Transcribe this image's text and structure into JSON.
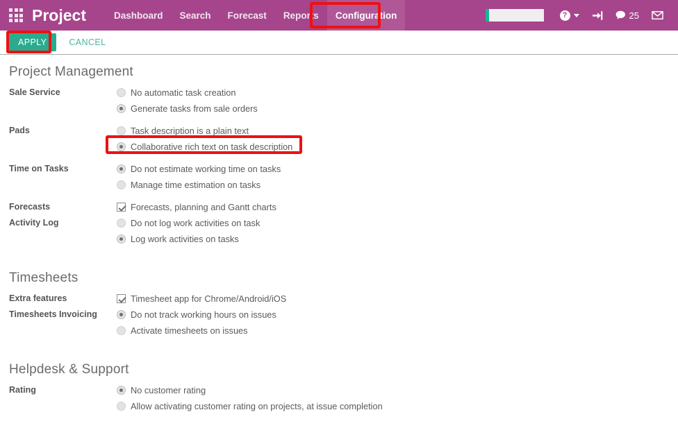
{
  "navbar": {
    "apps_icon": "apps-grid-icon",
    "brand": "Project",
    "menu": [
      {
        "label": "Dashboard",
        "active": false
      },
      {
        "label": "Search",
        "active": false
      },
      {
        "label": "Forecast",
        "active": false
      },
      {
        "label": "Reports",
        "active": false
      },
      {
        "label": "Configuration",
        "active": true
      }
    ],
    "search": {
      "value": "",
      "placeholder": ""
    },
    "help_icon": "question-mark-icon",
    "caret_icon": "chevron-down-icon",
    "signin_icon": "sign-in-arrow-icon",
    "messages_icon": "speech-bubble-icon",
    "messages_count": "25",
    "mail_icon": "envelope-icon",
    "background_color": "#a6458c",
    "active_color": "#b05798"
  },
  "toolbar": {
    "apply_label": "APPLY",
    "cancel_label": "CANCEL",
    "apply_color": "#2aab8e",
    "cancel_color": "#4ab5a0"
  },
  "sections": [
    {
      "title": "Project Management",
      "rows": [
        {
          "label": "Sale Service",
          "options": [
            {
              "type": "radio",
              "checked": false,
              "label": "No automatic task creation"
            },
            {
              "type": "radio",
              "checked": true,
              "label": "Generate tasks from sale orders"
            }
          ]
        },
        {
          "label": "Pads",
          "options": [
            {
              "type": "radio",
              "checked": false,
              "label": "Task description is a plain text"
            },
            {
              "type": "radio",
              "checked": true,
              "label": "Collaborative rich text on task description"
            }
          ]
        },
        {
          "label": "Time on Tasks",
          "options": [
            {
              "type": "radio",
              "checked": true,
              "label": "Do not estimate working time on tasks"
            },
            {
              "type": "radio",
              "checked": false,
              "label": "Manage time estimation on tasks"
            }
          ]
        },
        {
          "label": "Forecasts",
          "options": [
            {
              "type": "checkbox",
              "checked": true,
              "label": "Forecasts, planning and Gantt charts"
            }
          ]
        },
        {
          "label": "Activity Log",
          "options": [
            {
              "type": "radio",
              "checked": false,
              "label": "Do not log work activities on task"
            },
            {
              "type": "radio",
              "checked": true,
              "label": "Log work activities on tasks"
            }
          ]
        }
      ]
    },
    {
      "title": "Timesheets",
      "rows": [
        {
          "label": "Extra features",
          "options": [
            {
              "type": "checkbox",
              "checked": true,
              "label": "Timesheet app for Chrome/Android/iOS"
            }
          ]
        },
        {
          "label": "Timesheets Invoicing",
          "options": [
            {
              "type": "radio",
              "checked": true,
              "label": "Do not track working hours on issues"
            },
            {
              "type": "radio",
              "checked": false,
              "label": "Activate timesheets on issues"
            }
          ]
        }
      ]
    },
    {
      "title": "Helpdesk & Support",
      "rows": [
        {
          "label": "Rating",
          "options": [
            {
              "type": "radio",
              "checked": true,
              "label": "No customer rating"
            },
            {
              "type": "radio",
              "checked": false,
              "label": "Allow activating customer rating on projects, at issue completion"
            }
          ]
        }
      ]
    }
  ],
  "highlights": {
    "color": "#ee1111",
    "targets": [
      "configuration-menu-item",
      "apply-button",
      "pads-collaborative-option"
    ]
  }
}
